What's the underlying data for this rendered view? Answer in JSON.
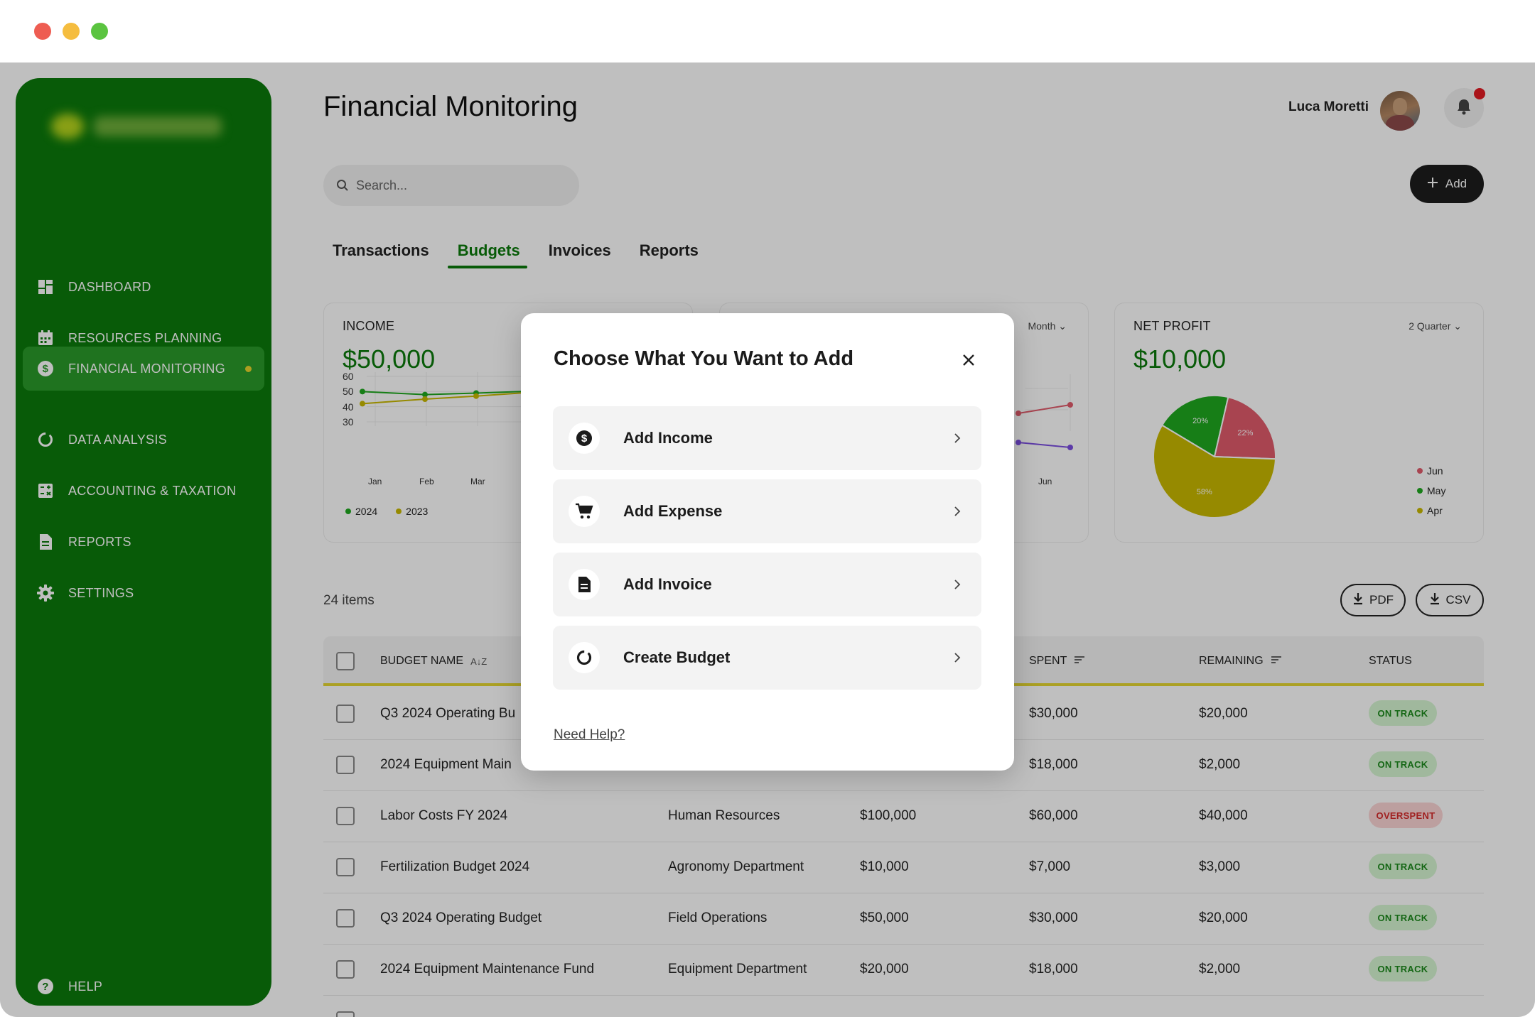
{
  "window": {
    "dots": [
      "#ee5d52",
      "#f5bd3f",
      "#5bc440"
    ]
  },
  "sidebar": {
    "items": [
      {
        "label": "DASHBOARD",
        "icon": "dashboard-icon"
      },
      {
        "label": "RESOURCES PLANNING",
        "icon": "calendar-icon"
      },
      {
        "label": "FINANCIAL MONITORING",
        "icon": "dollar-icon",
        "active": true
      },
      {
        "label": "DATA ANALYSIS",
        "icon": "chart-ring-icon"
      },
      {
        "label": "ACCOUNTING & TAXATION",
        "icon": "calculator-icon"
      },
      {
        "label": "REPORTS",
        "icon": "document-icon"
      },
      {
        "label": "SETTINGS",
        "icon": "gear-icon"
      }
    ],
    "help_label": "HELP"
  },
  "header": {
    "title": "Financial Monitoring",
    "user_name": "Luca Moretti"
  },
  "search": {
    "placeholder": "Search..."
  },
  "add_button": {
    "label": "Add"
  },
  "tabs": [
    {
      "label": "Transactions"
    },
    {
      "label": "Budgets",
      "active": true
    },
    {
      "label": "Invoices"
    },
    {
      "label": "Reports"
    }
  ],
  "cards": {
    "income": {
      "title": "INCOME",
      "value": "$50,000",
      "chart_data": {
        "type": "line",
        "x": [
          "Jan",
          "Feb",
          "Mar"
        ],
        "yticks": [
          60,
          50,
          40,
          30
        ],
        "ylim": [
          30,
          60
        ],
        "series": [
          {
            "name": "2024",
            "values": [
              50,
              48,
              49
            ],
            "color": "#1fa91f"
          },
          {
            "name": "2023",
            "values": [
              42,
              45,
              47
            ],
            "color": "#c9b800"
          }
        ]
      }
    },
    "expenses": {
      "dropdown": "Month",
      "x_label": "Jun"
    },
    "net_profit": {
      "title": "NET PROFIT",
      "value": "$10,000",
      "dropdown": "2 Quarter",
      "chart_data": {
        "type": "pie",
        "slices": [
          {
            "name": "Jun",
            "value": 22,
            "label": "22%",
            "color": "#e05b6b"
          },
          {
            "name": "May",
            "value": 20,
            "label": "20%",
            "color": "#1fa91f"
          },
          {
            "name": "Apr",
            "value": 58,
            "label": "58%",
            "color": "#c9b800"
          }
        ]
      }
    }
  },
  "list": {
    "count": "24 items",
    "pdf_label": "PDF",
    "csv_label": "CSV"
  },
  "table": {
    "columns": [
      "BUDGET NAME",
      "SPENT",
      "REMAINING",
      "STATUS"
    ],
    "rows": [
      {
        "name": "Q3 2024 Operating Bu",
        "dept": "",
        "budget": "",
        "spent": "$30,000",
        "remaining": "$20,000",
        "status": "ON TRACK"
      },
      {
        "name": "2024 Equipment Main",
        "dept": "",
        "budget": "",
        "spent": "$18,000",
        "remaining": "$2,000",
        "status": "ON TRACK"
      },
      {
        "name": "Labor Costs FY 2024",
        "dept": "Human Resources",
        "budget": "$100,000",
        "spent": "$60,000",
        "remaining": "$40,000",
        "status": "OVERSPENT"
      },
      {
        "name": "Fertilization Budget 2024",
        "dept": "Agronomy Department",
        "budget": "$10,000",
        "spent": "$7,000",
        "remaining": "$3,000",
        "status": "ON TRACK"
      },
      {
        "name": "Q3 2024 Operating Budget",
        "dept": "Field Operations",
        "budget": "$50,000",
        "spent": "$30,000",
        "remaining": "$20,000",
        "status": "ON TRACK"
      },
      {
        "name": "2024 Equipment Maintenance Fund",
        "dept": "Equipment Department",
        "budget": "$20,000",
        "spent": "$18,000",
        "remaining": "$2,000",
        "status": "ON TRACK"
      }
    ]
  },
  "modal": {
    "title": "Choose What You Want to Add",
    "options": [
      {
        "label": "Add Income",
        "icon": "dollar-circle-icon"
      },
      {
        "label": "Add Expense",
        "icon": "cart-icon"
      },
      {
        "label": "Add Invoice",
        "icon": "document-icon"
      },
      {
        "label": "Create Budget",
        "icon": "budget-ring-icon"
      }
    ],
    "help_link": "Need Help?"
  }
}
